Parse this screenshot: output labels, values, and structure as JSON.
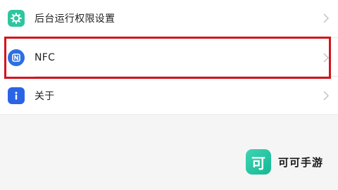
{
  "settings": {
    "items": [
      {
        "label": "后台运行权限设置",
        "icon": "gear-icon",
        "icon_color": "#2fc59f"
      },
      {
        "label": "NFC",
        "icon": "nfc-icon",
        "icon_color": "#2d6fe0"
      },
      {
        "label": "关于",
        "icon": "info-icon",
        "icon_color": "#2a64e6"
      }
    ]
  },
  "highlight": {
    "target": "NFC",
    "color": "#d4141c"
  },
  "watermark": {
    "logo_char": "可",
    "text": "可可手游",
    "logo_color": "#22c3a0"
  }
}
